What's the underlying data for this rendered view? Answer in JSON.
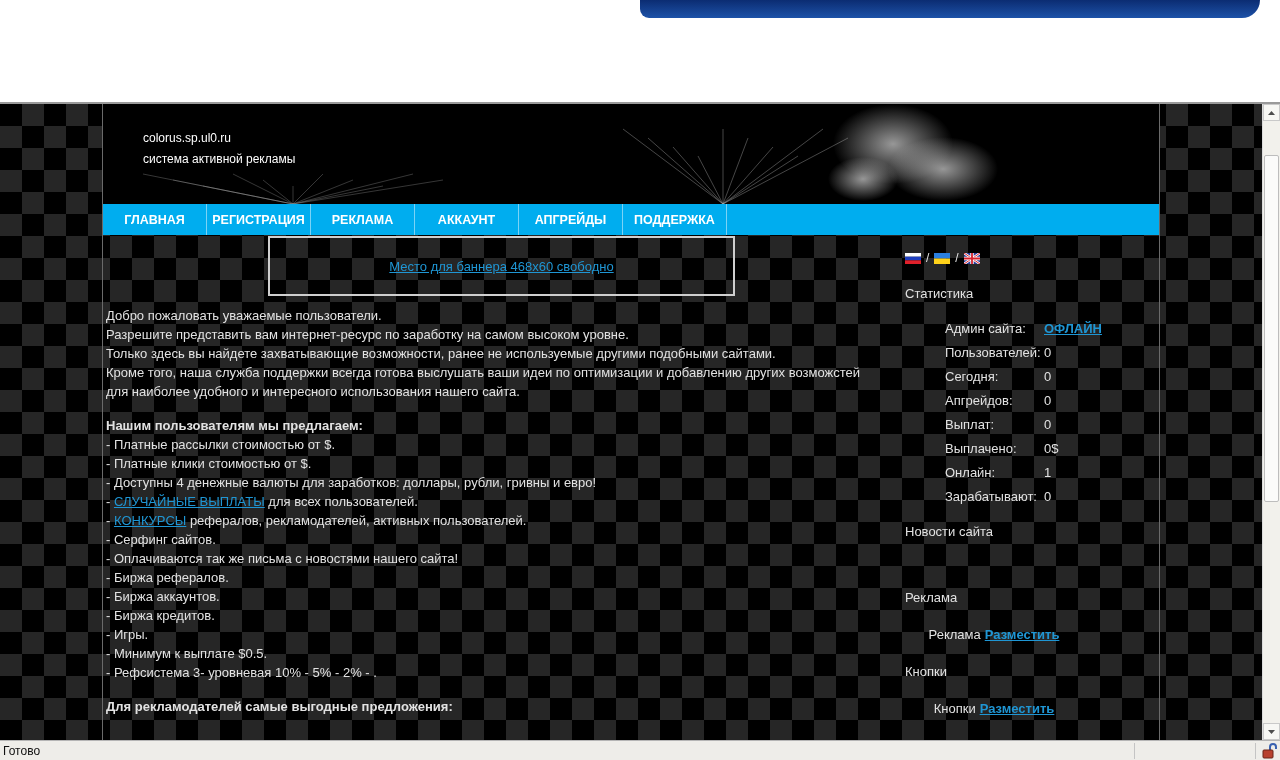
{
  "header": {
    "site_name": "colorus.sp.ul0.ru",
    "tagline": "система активной рекламы"
  },
  "nav": [
    {
      "label": "ГЛАВНАЯ"
    },
    {
      "label": "РЕГИСТРАЦИЯ"
    },
    {
      "label": "РЕКЛАМА"
    },
    {
      "label": "АККАУНТ"
    },
    {
      "label": "АПГРЕЙДЫ"
    },
    {
      "label": "ПОДДЕРЖКА"
    }
  ],
  "banner": {
    "link": "Место для баннера 468x60 свободно"
  },
  "intro": [
    "Добро пожаловать уважаемые пользователи.",
    "Разрешите представить вам интернет-ресурс по заработку на самом высоком уровне.",
    "Только здесь вы найдете захватывающие возможности, ранее не используемые другими подобными сайтами.",
    "Кроме того, наша служба поддержки всегда готова выслушать ваши идеи по оптимизации и добавлению других возможстей для наиболее удобного и интересного использования нашего сайта."
  ],
  "offers": {
    "heading": "Нашим пользователям мы предлагаем:",
    "items": [
      {
        "kind": "plain",
        "text": "- Платные рассылки стоимостью от $."
      },
      {
        "kind": "plain",
        "text": "- Платные клики стоимостью от $."
      },
      {
        "kind": "plain",
        "text": "- Доступны 4 денежные валюты для заработков: доллары, рубли, гривны и евро!"
      },
      {
        "kind": "link",
        "prefix": "- ",
        "link": "СЛУЧАЙНЫЕ ВЫПЛАТЫ",
        "text": " для всех пользователей."
      },
      {
        "kind": "link",
        "prefix": "- ",
        "link": "КОНКУРСЫ",
        "text": " рефералов, рекламодателей, активных пользователей."
      },
      {
        "kind": "plain",
        "text": "- Серфинг сайтов."
      },
      {
        "kind": "plain",
        "text": "- Оплачиваются так же письма с новостями нашего сайта!"
      },
      {
        "kind": "plain",
        "text": "- Биржа рефералов."
      },
      {
        "kind": "plain",
        "text": "- Биржа аккаунтов."
      },
      {
        "kind": "plain",
        "text": "- Биржа кредитов."
      },
      {
        "kind": "plain",
        "text": "- Игры."
      },
      {
        "kind": "plain",
        "text": "- Минимум к выплате $0.5."
      },
      {
        "kind": "plain",
        "text": "- Рефсистема 3- уровневая 10% - 5% - 2% - ."
      }
    ]
  },
  "advertisers": {
    "heading": "Для рекламодателей самые выгодные предложения:"
  },
  "sidebar": {
    "languages": [
      {
        "kind": "russia"
      },
      {
        "kind": "ukraine"
      },
      {
        "kind": "uk"
      }
    ],
    "language_separators": [
      "/",
      "/"
    ],
    "stats_title": "Статистика",
    "stats": [
      {
        "label": "Админ сайта:",
        "value": "ОФЛАЙН",
        "kind": "link"
      },
      {
        "label": "Пользователей:",
        "value": "0",
        "kind": "plain"
      },
      {
        "label": "Сегодня:",
        "value": "0",
        "kind": "plain"
      },
      {
        "label": "Апгрейдов:",
        "value": "0",
        "kind": "plain"
      },
      {
        "label": "Выплат:",
        "value": "0",
        "kind": "plain"
      },
      {
        "label": "Выплачено:",
        "value": "0$",
        "kind": "plain"
      },
      {
        "label": "Онлайн:",
        "value": "1",
        "kind": "plain"
      },
      {
        "label": "Зарабатывают:",
        "value": "0",
        "kind": "plain"
      }
    ],
    "news_title": "Новости сайта",
    "ads": {
      "title": "Реклама",
      "label": "Реклама",
      "link": "Разместить"
    },
    "buttons": {
      "title": "Кнопки",
      "label": "Кнопки",
      "link": "Разместить"
    }
  },
  "status_bar": {
    "text": "Готово"
  }
}
